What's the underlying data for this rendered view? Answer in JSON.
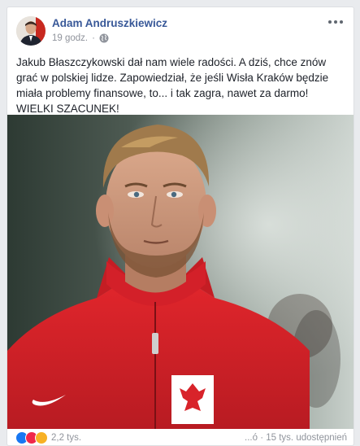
{
  "post": {
    "author": "Adam Andruszkiewicz",
    "time": "19 godz.",
    "privacy_icon": "globe-icon",
    "more_icon": "more-options-icon",
    "text": "Jakub Błaszczykowski dał nam wiele radości. A dziś, chce znów grać w polskiej lidze. Zapowiedział, że jeśli Wisła Kraków będzie miała problemy finansowe, to... i tak zagra, nawet za darmo! WIELKI SZACUNEK!",
    "photo_icon": "player-photo",
    "reaction_icons": [
      "like-icon",
      "love-icon",
      "wow-icon"
    ],
    "reaction_count": "2,2 tys.",
    "stats": "...ó  ·  15 tys. udostępnień"
  },
  "colors": {
    "link": "#385898",
    "meta": "#90949c",
    "jersey": "#d8232a"
  }
}
